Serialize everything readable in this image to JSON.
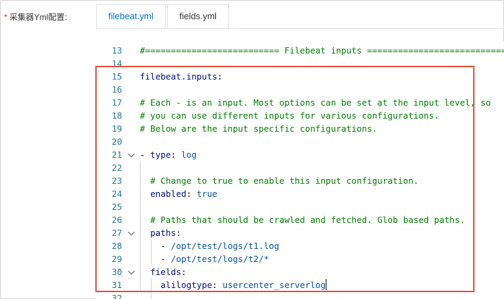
{
  "field": {
    "required_mark": "*",
    "label": "采集器Yml配置:"
  },
  "tabs": [
    {
      "label": "filebeat.yml",
      "active": true
    },
    {
      "label": "fields.yml",
      "active": false
    }
  ],
  "editor": {
    "lines": [
      {
        "num": "13",
        "fold": false,
        "indent": "",
        "tokens": [
          {
            "t": "comment",
            "v": "#========================== Filebeat inputs ============================="
          }
        ]
      },
      {
        "num": "14",
        "fold": false,
        "indent": "",
        "tokens": []
      },
      {
        "num": "15",
        "fold": false,
        "indent": "",
        "tokens": [
          {
            "t": "key",
            "v": "filebeat.inputs"
          },
          {
            "t": "plain",
            "v": ":"
          }
        ]
      },
      {
        "num": "16",
        "fold": false,
        "indent": "",
        "tokens": []
      },
      {
        "num": "17",
        "fold": false,
        "indent": "",
        "tokens": [
          {
            "t": "comment",
            "v": "# Each - is an input. Most options can be set at the input level, so"
          }
        ]
      },
      {
        "num": "18",
        "fold": false,
        "indent": "",
        "tokens": [
          {
            "t": "comment",
            "v": "# you can use different inputs for various configurations."
          }
        ]
      },
      {
        "num": "19",
        "fold": false,
        "indent": "",
        "tokens": [
          {
            "t": "comment",
            "v": "# Below are the input specific configurations."
          }
        ]
      },
      {
        "num": "20",
        "fold": false,
        "indent": "",
        "tokens": []
      },
      {
        "num": "21",
        "fold": true,
        "indent": "",
        "tokens": [
          {
            "t": "plain",
            "v": "- "
          },
          {
            "t": "key",
            "v": "type"
          },
          {
            "t": "plain",
            "v": ": "
          },
          {
            "t": "val",
            "v": "log"
          }
        ]
      },
      {
        "num": "22",
        "fold": false,
        "indent": "",
        "tokens": []
      },
      {
        "num": "23",
        "fold": false,
        "indent": "  ",
        "tokens": [
          {
            "t": "comment",
            "v": "# Change to true to enable this input configuration."
          }
        ]
      },
      {
        "num": "24",
        "fold": false,
        "indent": "  ",
        "tokens": [
          {
            "t": "key",
            "v": "enabled"
          },
          {
            "t": "plain",
            "v": ": "
          },
          {
            "t": "val",
            "v": "true"
          }
        ]
      },
      {
        "num": "25",
        "fold": false,
        "indent": "",
        "tokens": []
      },
      {
        "num": "26",
        "fold": false,
        "indent": "  ",
        "tokens": [
          {
            "t": "comment",
            "v": "# Paths that should be crawled and fetched. Glob based paths."
          }
        ]
      },
      {
        "num": "27",
        "fold": true,
        "indent": "  ",
        "tokens": [
          {
            "t": "key",
            "v": "paths"
          },
          {
            "t": "plain",
            "v": ":"
          }
        ]
      },
      {
        "num": "28",
        "fold": false,
        "indent": "    ",
        "tokens": [
          {
            "t": "plain",
            "v": "- "
          },
          {
            "t": "val",
            "v": "/opt/test/logs/t1.log"
          }
        ]
      },
      {
        "num": "29",
        "fold": false,
        "indent": "    ",
        "tokens": [
          {
            "t": "plain",
            "v": "- "
          },
          {
            "t": "val",
            "v": "/opt/test/logs/t2/*"
          }
        ]
      },
      {
        "num": "30",
        "fold": true,
        "indent": "  ",
        "tokens": [
          {
            "t": "key",
            "v": "fields"
          },
          {
            "t": "plain",
            "v": ":"
          }
        ]
      },
      {
        "num": "31",
        "fold": false,
        "indent": "    ",
        "tokens": [
          {
            "t": "key",
            "v": "alilogtype"
          },
          {
            "t": "plain",
            "v": ": "
          },
          {
            "t": "val",
            "v": "usercenter_serverlog"
          }
        ],
        "cursor": true
      },
      {
        "num": "32",
        "fold": false,
        "indent": "",
        "tokens": []
      }
    ]
  },
  "colors": {
    "highlight_box": "#e44d3a",
    "tab_active": "#0070cc",
    "line_number": "#237893",
    "comment": "#008000",
    "key": "#001080",
    "value": "#0451a5"
  }
}
